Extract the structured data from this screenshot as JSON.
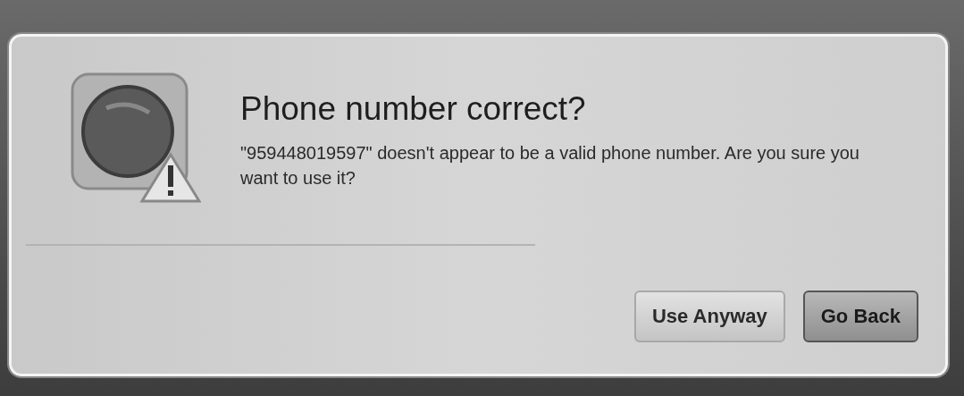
{
  "dialog": {
    "title": "Phone number correct?",
    "message": "\"959448019597\" doesn't appear to be a valid phone number. Are you sure you want to use it?",
    "buttons": [
      {
        "label": "Use Anyway",
        "default": false
      },
      {
        "label": "Go Back",
        "default": true
      }
    ]
  }
}
